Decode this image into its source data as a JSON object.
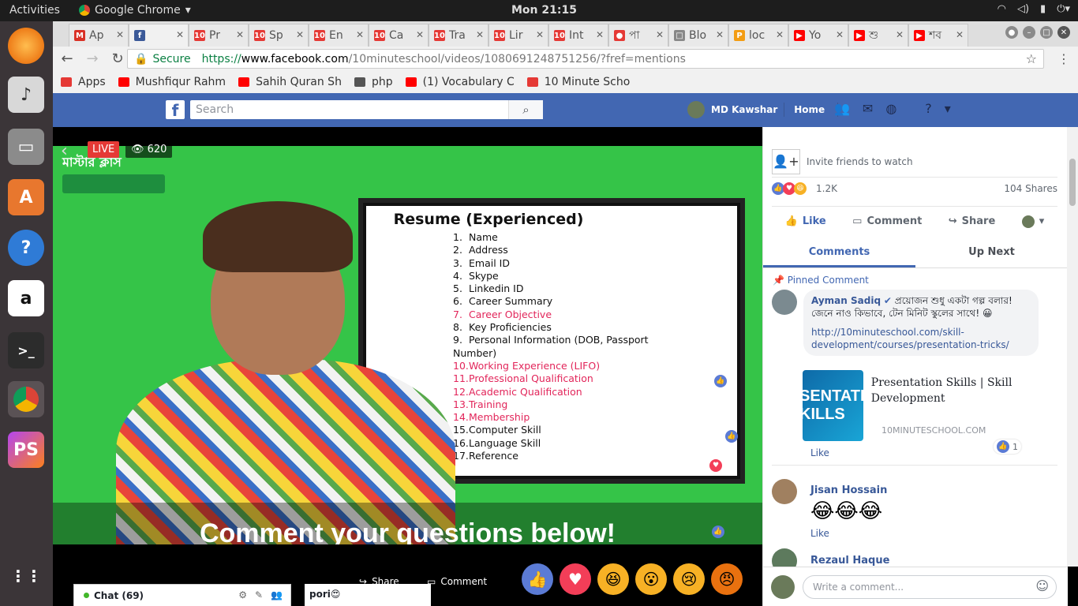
{
  "os": {
    "activities": "Activities",
    "app_name": "Google Chrome",
    "clock": "Mon 21:15"
  },
  "browser": {
    "tabs": [
      {
        "label": "Ap",
        "icon_color": "#d93025",
        "icon": "M"
      },
      {
        "label": "",
        "icon_color": "#3b5998",
        "icon": "f",
        "active": true
      },
      {
        "label": "Pr",
        "icon_color": "#e53935",
        "icon": "10"
      },
      {
        "label": "Sp",
        "icon_color": "#e53935",
        "icon": "10"
      },
      {
        "label": "En",
        "icon_color": "#e53935",
        "icon": "10"
      },
      {
        "label": "Ca",
        "icon_color": "#e53935",
        "icon": "10"
      },
      {
        "label": "Tra",
        "icon_color": "#e53935",
        "icon": "10"
      },
      {
        "label": "Lir",
        "icon_color": "#e53935",
        "icon": "10"
      },
      {
        "label": "Int",
        "icon_color": "#e53935",
        "icon": "10"
      },
      {
        "label": "পা",
        "icon_color": "#e53935",
        "icon": "●"
      },
      {
        "label": "Blo",
        "icon_color": "#888888",
        "icon": "□"
      },
      {
        "label": "loc",
        "icon_color": "#f39c12",
        "icon": "P"
      },
      {
        "label": "Yo",
        "icon_color": "#ff0000",
        "icon": "▶"
      },
      {
        "label": "শু",
        "icon_color": "#ff0000",
        "icon": "▶"
      },
      {
        "label": "শব",
        "icon_color": "#ff0000",
        "icon": "▶"
      }
    ],
    "secure_label": "Secure",
    "url_scheme": "https://",
    "url_host": "www.facebook.com",
    "url_path": "/10minuteschool/videos/1080691248751256/?fref=mentions",
    "bookmarks": [
      {
        "label": "Apps",
        "icon_color": "#e53935"
      },
      {
        "label": "Mushfiqur Rahm",
        "icon_color": "#ff0000"
      },
      {
        "label": "Sahih Quran Sh",
        "icon_color": "#ff0000"
      },
      {
        "label": "php",
        "icon_color": "#555555"
      },
      {
        "label": "(1) Vocabulary C",
        "icon_color": "#ff0000"
      },
      {
        "label": "10 Minute Scho",
        "icon_color": "#e53935"
      }
    ]
  },
  "facebook": {
    "search_placeholder": "Search",
    "user_name": "MD Kawshar",
    "home_label": "Home",
    "brand_color": "#4267b2"
  },
  "video": {
    "live_label": "LIVE",
    "view_count": "620",
    "logo_text": "মাস্টার ক্লাস",
    "resume_title": "Resume (Experienced)",
    "resume_items": [
      {
        "n": "1.",
        "text": "Name",
        "red": false
      },
      {
        "n": "2.",
        "text": "Address",
        "red": false
      },
      {
        "n": "3.",
        "text": "Email ID",
        "red": false
      },
      {
        "n": "4.",
        "text": "Skype",
        "red": false
      },
      {
        "n": "5.",
        "text": "Linkedin ID",
        "red": false
      },
      {
        "n": "6.",
        "text": "Career Summary",
        "red": false
      },
      {
        "n": "7.",
        "text": "Career Objective",
        "red": true
      },
      {
        "n": "8.",
        "text": "Key Proficiencies",
        "red": false
      },
      {
        "n": "9.",
        "text": "Personal Information (DOB, Passport Number)",
        "red": false
      },
      {
        "n": "10.",
        "text": "Working Experience (LIFO)",
        "red": true
      },
      {
        "n": "11.",
        "text": "Professional Qualification",
        "red": true
      },
      {
        "n": "12.",
        "text": "Academic Qualification",
        "red": true
      },
      {
        "n": "13.",
        "text": "Training",
        "red": true
      },
      {
        "n": "14.",
        "text": "Membership",
        "red": true
      },
      {
        "n": "15.",
        "text": "Computer Skill",
        "red": false
      },
      {
        "n": "16.",
        "text": "Language Skill",
        "red": false
      },
      {
        "n": "17.",
        "text": "Reference",
        "red": false
      }
    ],
    "caption": "Comment your questions below!",
    "share_label": "Share",
    "comment_label": "Comment"
  },
  "chat": {
    "label": "Chat (69)",
    "pori_label": "pori😍"
  },
  "sidebar": {
    "invite_label": "Invite friends to watch",
    "reaction_count": "1.2K",
    "shares": "104 Shares",
    "like_label": "Like",
    "comment_label": "Comment",
    "share_label": "Share",
    "tab_comments": "Comments",
    "tab_upnext": "Up Next",
    "pinned_label": "Pinned Comment",
    "comments": [
      {
        "name": "Ayman Sadiq",
        "text": "প্রয়োজন শুধু একটা গল্প বলার! জেনে নাও কিভাবে, টেন মিনিট স্কুলের সাথে! 😀",
        "link": "http://10minuteschool.com/skill-development/courses/presentation-tricks/",
        "preview_title": "Presentation Skills | Skill Development",
        "preview_domain": "10MINUTESCHOOL.COM",
        "preview_image_text": "ESENTATIO SKILLS",
        "like_label": "Like",
        "like_count": "1"
      },
      {
        "name": "Jisan Hossain",
        "text": "😂😂😂",
        "like_label": "Like"
      },
      {
        "name": "Rezaul Haque"
      }
    ],
    "write_placeholder": "Write a comment..."
  }
}
